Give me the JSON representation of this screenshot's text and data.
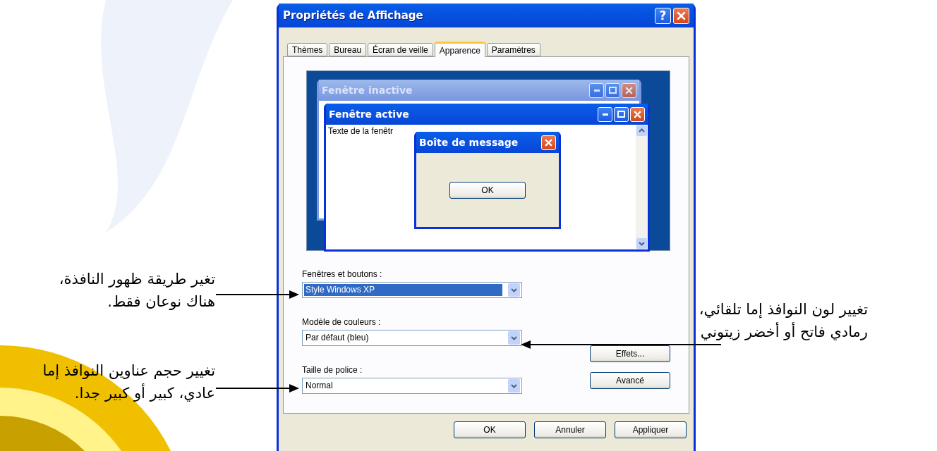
{
  "dialog": {
    "title": "Propriétés de Affichage",
    "help_button": "?"
  },
  "tabs": [
    {
      "label": "Thèmes",
      "selected": false
    },
    {
      "label": "Bureau",
      "selected": false
    },
    {
      "label": "Écran de veille",
      "selected": false
    },
    {
      "label": "Apparence",
      "selected": true
    },
    {
      "label": "Paramètres",
      "selected": false
    }
  ],
  "preview": {
    "inactive_window": {
      "title": "Fenêtre inactive"
    },
    "active_window": {
      "title": "Fenêtre active",
      "text": "Texte de la fenêtr"
    },
    "message_box": {
      "title": "Boîte de message",
      "button": "OK"
    }
  },
  "fields": [
    {
      "label": "Fenêtres et boutons :",
      "value": "Style Windows XP",
      "selected": true
    },
    {
      "label": "Modèle de couleurs :",
      "value": "Par défaut (bleu)",
      "selected": false
    },
    {
      "label": "Taille de police :",
      "value": "Normal",
      "selected": false
    }
  ],
  "side_buttons": [
    "Effets...",
    "Avancé"
  ],
  "buttons": [
    "OK",
    "Annuler",
    "Appliquer"
  ],
  "left_annotations": [
    "تغير طريقة ظهور النافذة، هناك نوعان فقط.",
    "تغيير حجم عناوين النوافذ إما عادي، كبير أو كبير جدا."
  ],
  "right_annotations": [
    "تغيير لون النوافذ إما تلقائي، رمادي فاتح أو أخضر زيتوني"
  ]
}
